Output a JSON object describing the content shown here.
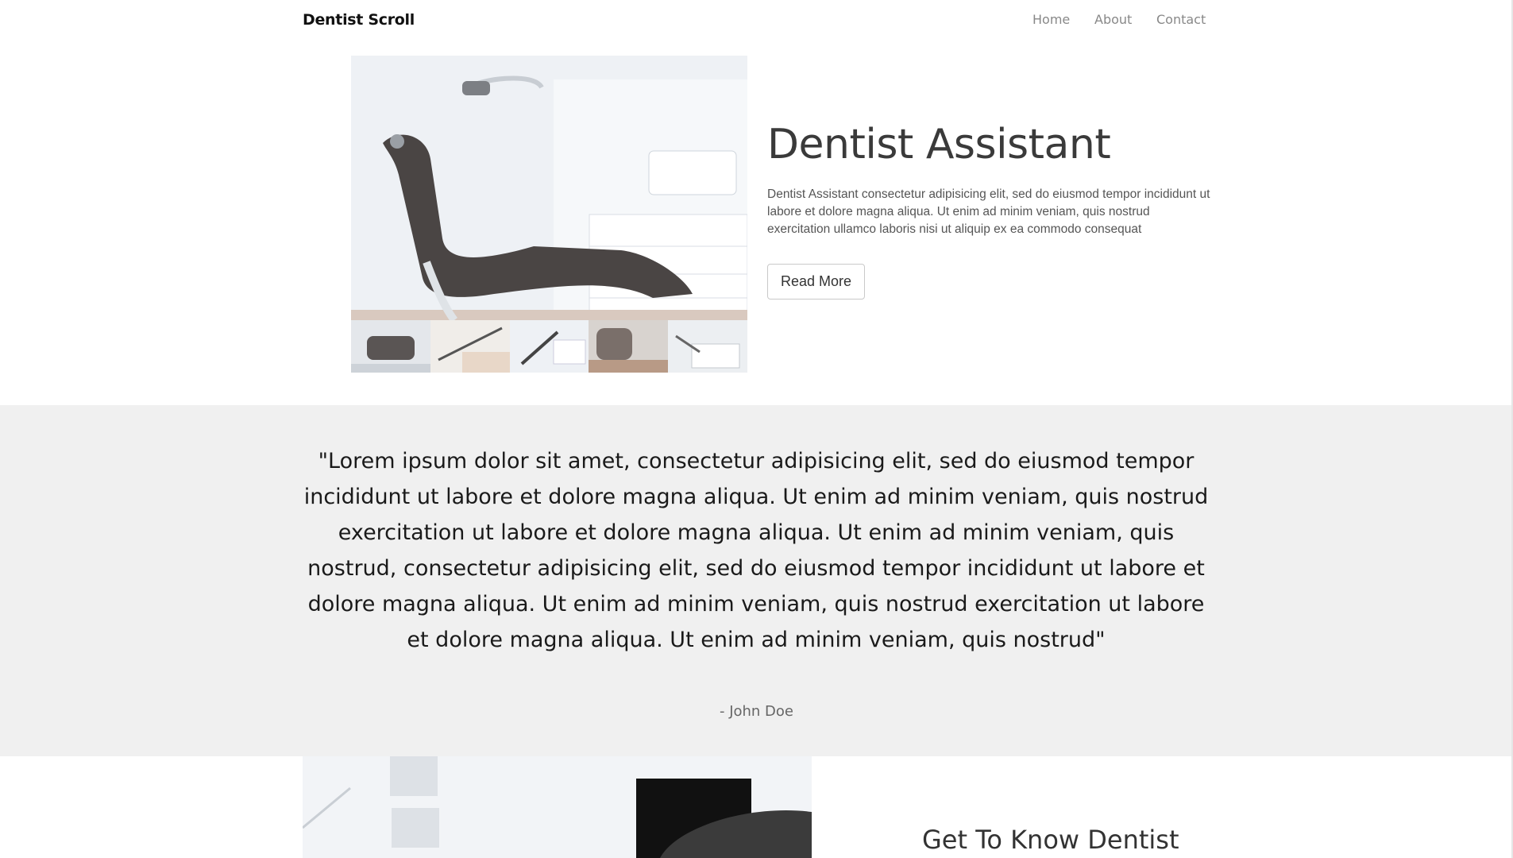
{
  "brand": "Dentist Scroll",
  "nav": [
    {
      "label": "Home",
      "name": "nav-home"
    },
    {
      "label": "About",
      "name": "nav-about"
    },
    {
      "label": "Contact",
      "name": "nav-contact"
    }
  ],
  "hero": {
    "title": "Dentist Assistant",
    "text": "Dentist Assistant consectetur adipisicing elit, sed do eiusmod tempor incididunt ut labore et dolore magna aliqua. Ut enim ad minim veniam, quis nostrud exercitation ullamco laboris nisi ut aliquip ex ea commodo consequat",
    "button": "Read More"
  },
  "quote": {
    "text": "\"Lorem ipsum dolor sit amet, consectetur adipisicing elit, sed do eiusmod tempor incididunt ut labore et dolore magna aliqua. Ut enim ad minim veniam, quis nostrud exercitation ut labore et dolore magna aliqua. Ut enim ad minim veniam, quis nostrud, consectetur adipisicing elit, sed do eiusmod tempor incididunt ut labore et dolore magna aliqua. Ut enim ad minim veniam, quis nostrud exercitation ut labore et dolore magna aliqua. Ut enim ad minim veniam, quis nostrud\"",
    "author": "- John Doe"
  },
  "about": {
    "title": "Get To Know Dentist"
  }
}
